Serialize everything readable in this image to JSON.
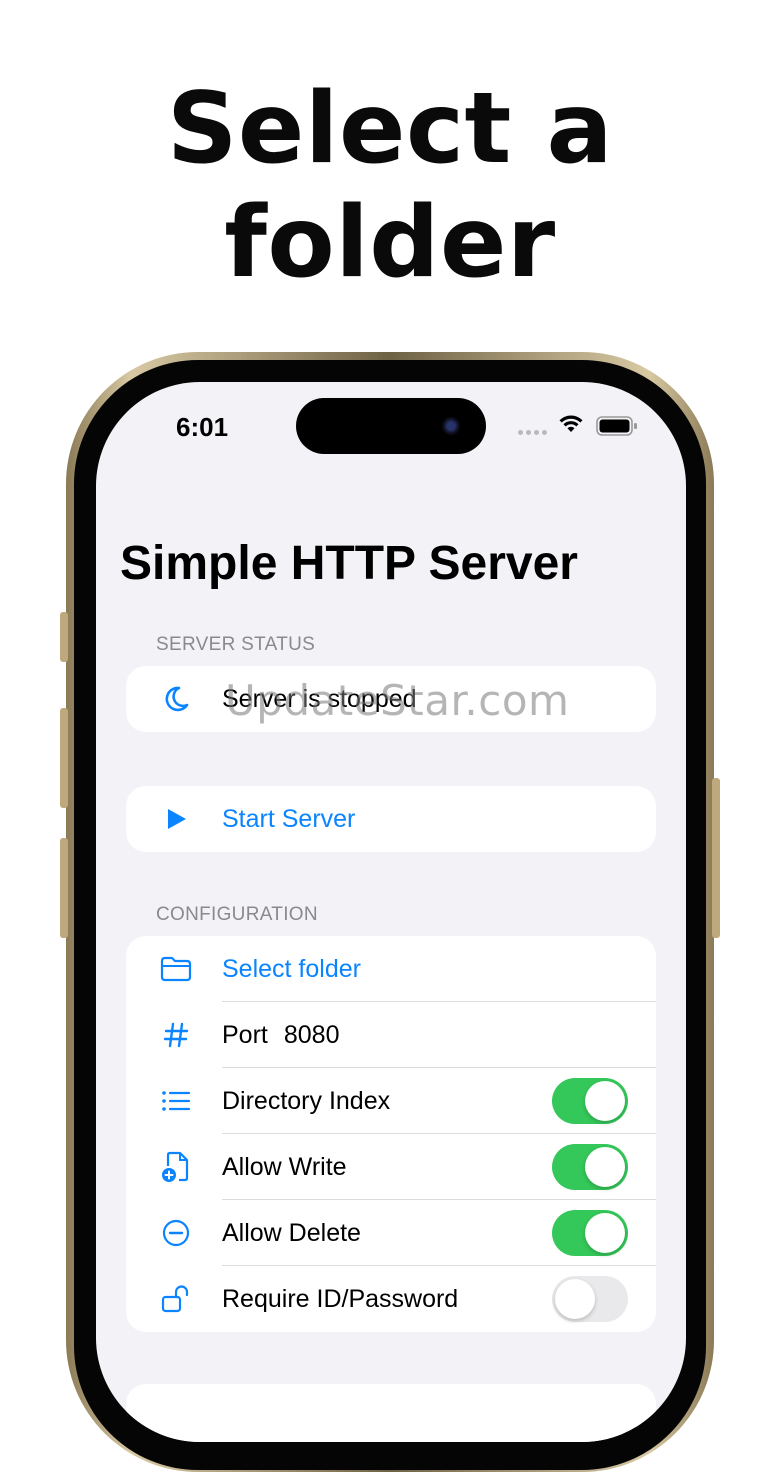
{
  "headline": "Select a folder",
  "status_bar": {
    "time": "6:01"
  },
  "app": {
    "title": "Simple HTTP Server",
    "server_status": {
      "header": "SERVER STATUS",
      "status_text": "Server is stopped"
    },
    "start_server_label": "Start Server",
    "configuration": {
      "header": "CONFIGURATION",
      "select_folder_label": "Select folder",
      "port_label": "Port",
      "port_value": "8080",
      "directory_index": {
        "label": "Directory Index",
        "enabled": true
      },
      "allow_write": {
        "label": "Allow Write",
        "enabled": true
      },
      "allow_delete": {
        "label": "Allow Delete",
        "enabled": true
      },
      "require_auth": {
        "label": "Require ID/Password",
        "enabled": false
      }
    }
  },
  "watermark": "UpdateStar.com",
  "colors": {
    "accent": "#0a84ff",
    "toggle_on": "#34c759",
    "toggle_off": "#e9e9eb",
    "background": "#f2f2f7"
  }
}
